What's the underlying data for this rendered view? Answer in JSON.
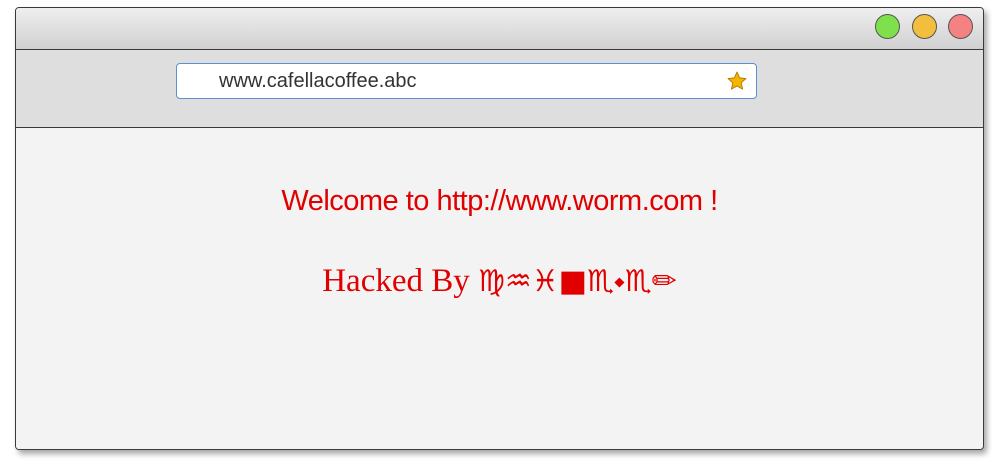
{
  "window": {
    "buttons": [
      {
        "name": "maximize",
        "color": "#7ee04a"
      },
      {
        "name": "minimize",
        "color": "#f2be3e"
      },
      {
        "name": "close",
        "color": "#f58282"
      }
    ]
  },
  "address_bar": {
    "url": "www.cafellacoffee.abc",
    "bookmark_icon": "star-icon",
    "bookmark_color": "#f4b400"
  },
  "page": {
    "welcome_text": "Welcome to http://www.worm.com !",
    "hacked_prefix": "Hacked By ",
    "hacked_glyphs": "♍♒♓■♏⬩♏✏",
    "text_color": "#e00000"
  }
}
